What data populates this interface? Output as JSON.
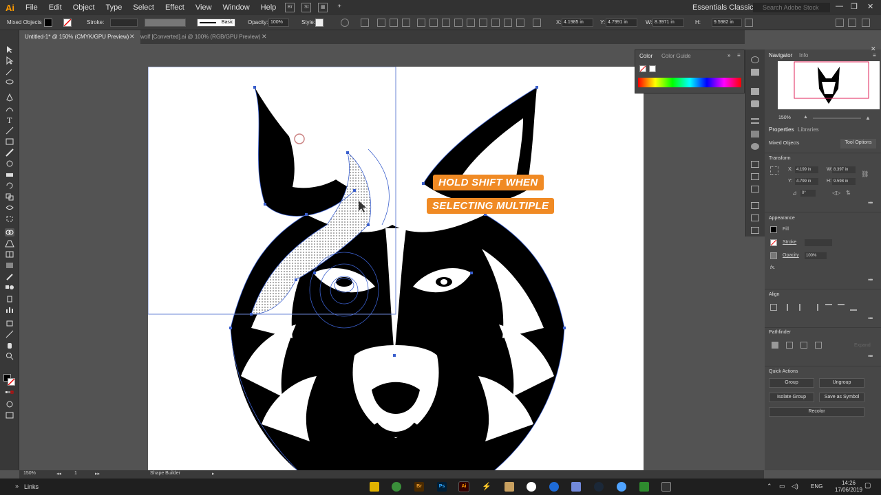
{
  "menubar": {
    "logo": "Ai",
    "items": [
      "File",
      "Edit",
      "Object",
      "Type",
      "Select",
      "Effect",
      "View",
      "Window",
      "Help"
    ],
    "bridge_icon": "Br",
    "stock_icon": "St",
    "workspace": "Essentials Classic",
    "search_placeholder": "Search Adobe Stock"
  },
  "control_bar": {
    "selection_label": "Mixed Objects",
    "stroke_label": "Stroke:",
    "brush_label": "Basic",
    "opacity_label": "Opacity:",
    "opacity_value": "100%",
    "style_label": "Style:",
    "x_label": "X:",
    "x_value": "4.1985 in",
    "y_label": "Y:",
    "y_value": "4.7991 in",
    "w_label": "W:",
    "w_value": "8.3971 in",
    "h_label": "H:",
    "h_value": "9.5982 in"
  },
  "tabs": [
    {
      "label": "Untitled-1* @ 150% (CMYK/GPU Preview)"
    },
    {
      "label": "wolf [Converted].ai @ 100% (RGB/GPU Preview)"
    }
  ],
  "caption": {
    "line1": "HOLD SHIFT WHEN",
    "line2": "SELECTING MULTIPLE"
  },
  "color_panel": {
    "tab1": "Color",
    "tab2": "Color Guide"
  },
  "navigator_panel": {
    "tab1": "Navigator",
    "tab2": "Info",
    "zoom": "150%"
  },
  "properties": {
    "tab1": "Properties",
    "tab2": "Libraries",
    "selection": "Mixed Objects",
    "tool_options": "Tool Options",
    "transform": "Transform",
    "x_label": "X:",
    "x_value": "4.199 in",
    "y_label": "Y:",
    "y_value": "4.799 in",
    "w_label": "W:",
    "w_value": "8.397 in",
    "h_label": "H:",
    "h_value": "9.598 in",
    "angle_value": "0°",
    "appearance": "Appearance",
    "fill_label": "Fill",
    "stroke_label": "Stroke",
    "opacity_label": "Opacity",
    "opacity_value": "100%",
    "fx_label": "fx.",
    "align": "Align",
    "pathfinder": "Pathfinder",
    "expand": "Expand",
    "quick_actions": "Quick Actions",
    "group": "Group",
    "ungroup": "Ungroup",
    "isolate_group": "Isolate Group",
    "save_as_symbol": "Save as Symbol",
    "recolor": "Recolor"
  },
  "status": {
    "zoom": "150%",
    "artboard_no": "1",
    "tool": "Shape Builder"
  },
  "taskbar": {
    "links": "Links",
    "br_icon": "Br",
    "ps_icon": "Ps",
    "ai_icon": "Ai",
    "lang": "ENG",
    "time": "14:26",
    "date": "17/06/2019"
  },
  "colors": {
    "caption_bg": "#f08a24",
    "selection_blue": "#3a5fcd",
    "ui_dark": "#323232",
    "panel": "#474747"
  }
}
